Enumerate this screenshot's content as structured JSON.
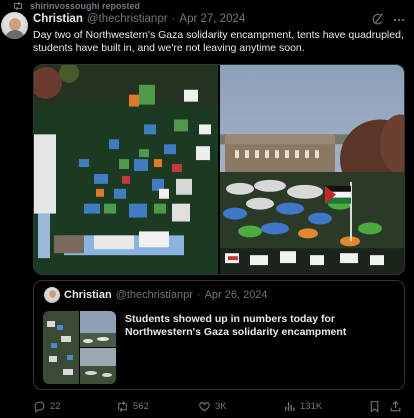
{
  "repost_header": {
    "text": "shirinvossoughi reposted",
    "icon": "repost-icon"
  },
  "post": {
    "author_name": "Christian",
    "handle": "@thechristianpr",
    "separator": "·",
    "date": "Apr 27, 2024",
    "text": "Day two of Northwestern's Gaza solidarity encampment, tents have quadrupled, students have built in, and we're not leaving anytime soon.",
    "icons": [
      "grok-icon",
      "more-icon"
    ]
  },
  "quoted_post": {
    "author_name": "Christian",
    "handle": "@thechristianpr",
    "separator": "·",
    "date": "Apr 26, 2024",
    "text": "Students showed up in numbers today for Northwestern's Gaza solidarity encampment"
  },
  "actions": {
    "replies": "22",
    "reposts": "562",
    "likes": "3K",
    "views": "131K",
    "icons": [
      "reply-icon",
      "repost-icon",
      "like-icon",
      "views-icon",
      "bookmark-icon",
      "share-icon"
    ]
  },
  "colors": {
    "background": "#000000",
    "text_primary": "#e7e9ea",
    "text_secondary": "#71767b",
    "border": "#2f3336"
  }
}
